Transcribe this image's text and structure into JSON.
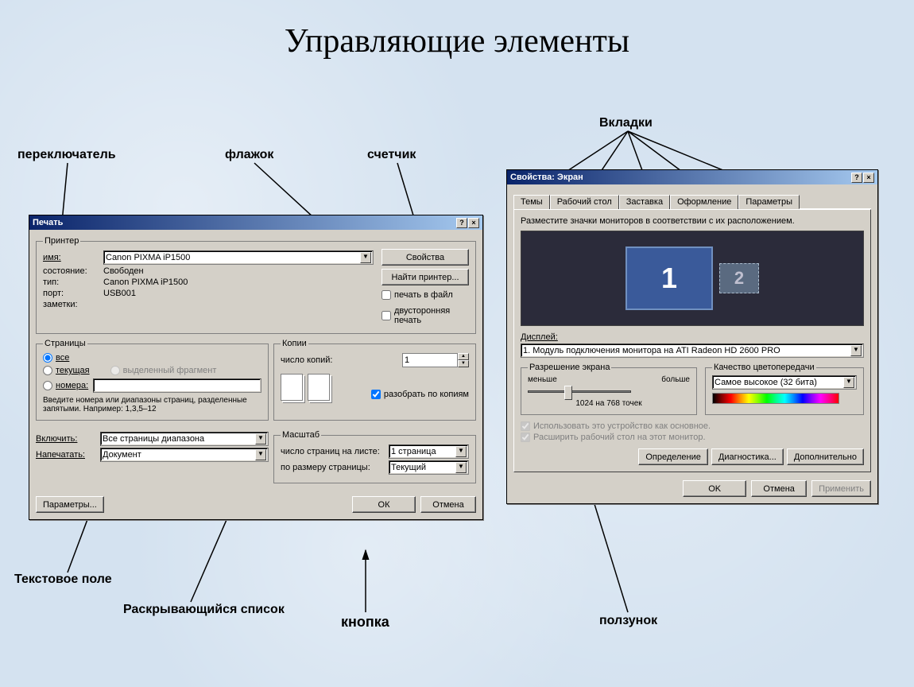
{
  "slide": {
    "title": "Управляющие элементы"
  },
  "callouts": {
    "switch": "переключатель",
    "flag": "флажок",
    "counter": "счетчик",
    "tabs": "Вкладки",
    "textfield": "Текстовое поле",
    "dropdown": "Раскрывающийся список",
    "button": "кнопка",
    "slider": "ползунок"
  },
  "print_dialog": {
    "title": "Печать",
    "printer_group": "Принтер",
    "name_label": "имя:",
    "name_value": "Canon PIXMA iP1500",
    "state_label": "состояние:",
    "state_value": "Свободен",
    "type_label": "тип:",
    "type_value": "Canon PIXMA iP1500",
    "port_label": "порт:",
    "port_value": "USB001",
    "notes_label": "заметки:",
    "properties_btn": "Свойства",
    "find_printer_btn": "Найти принтер...",
    "print_to_file": "печать в файл",
    "duplex": "двусторонняя печать",
    "pages_group": "Страницы",
    "pages_all": "все",
    "pages_current": "текущая",
    "pages_selection": "выделенный фрагмент",
    "pages_numbers": "номера:",
    "pages_hint": "Введите номера или диапазоны страниц, разделенные запятыми. Например: 1,3,5–12",
    "copies_group": "Копии",
    "copies_label": "число копий:",
    "copies_value": "1",
    "collate": "разобрать по копиям",
    "include_label": "Включить:",
    "include_value": "Все страницы диапазона",
    "print_label": "Напечатать:",
    "print_value": "Документ",
    "scale_group": "Масштаб",
    "pages_per_sheet_label": "число страниц на листе:",
    "pages_per_sheet_value": "1 страница",
    "fit_label": "по размеру страницы:",
    "fit_value": "Текущий",
    "params_btn": "Параметры...",
    "ok_btn": "ОК",
    "cancel_btn": "Отмена"
  },
  "display_dialog": {
    "title": "Свойства: Экран",
    "tabs": [
      "Темы",
      "Рабочий стол",
      "Заставка",
      "Оформление",
      "Параметры"
    ],
    "active_tab": "Параметры",
    "arrange_text": "Разместите значки мониторов в соответствии с их расположением.",
    "display_label": "Дисплей:",
    "display_value": "1. Модуль подключения монитора на ATI Radeon HD 2600 PRO",
    "resolution_group": "Разрешение экрана",
    "res_less": "меньше",
    "res_more": "больше",
    "res_value": "1024 на 768 точек",
    "quality_group": "Качество цветопередачи",
    "quality_value": "Самое высокое (32 бита)",
    "use_primary": "Использовать это устройство как основное.",
    "extend": "Расширить рабочий стол на этот монитор.",
    "identify_btn": "Определение",
    "diagnose_btn": "Диагностика...",
    "advanced_btn": "Дополнительно",
    "ok_btn": "OK",
    "cancel_btn": "Отмена",
    "apply_btn": "Применить",
    "mon1": "1",
    "mon2": "2"
  }
}
